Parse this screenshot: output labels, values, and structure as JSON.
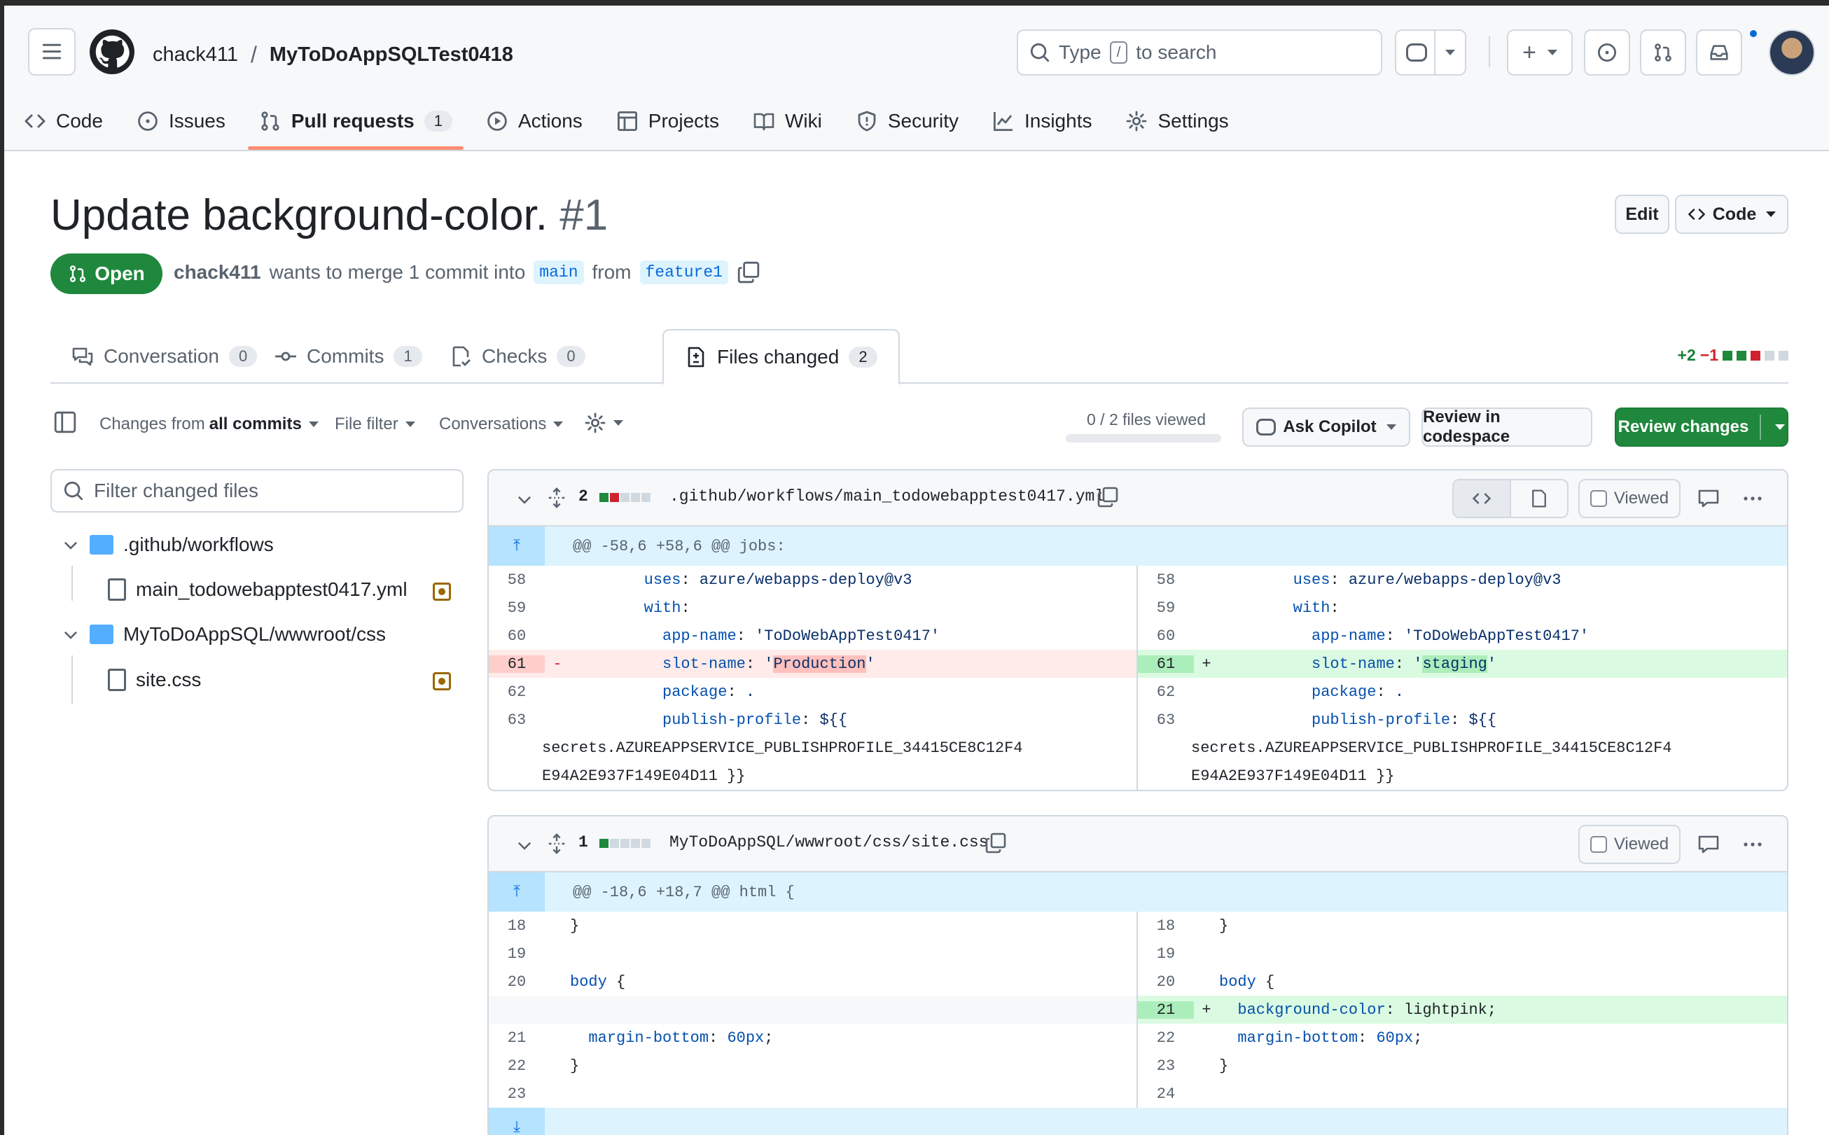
{
  "header": {
    "owner": "chack411",
    "separator": "/",
    "repo": "MyToDoAppSQLTest0418",
    "search": {
      "prefix": "Type",
      "key": "/",
      "suffix": "to search"
    }
  },
  "repo_tabs": [
    {
      "label": "Code",
      "icon": "code-icon"
    },
    {
      "label": "Issues",
      "icon": "issue-icon"
    },
    {
      "label": "Pull requests",
      "icon": "pull-request-icon",
      "count": "1",
      "active": true
    },
    {
      "label": "Actions",
      "icon": "play-icon"
    },
    {
      "label": "Projects",
      "icon": "table-icon"
    },
    {
      "label": "Wiki",
      "icon": "book-icon"
    },
    {
      "label": "Security",
      "icon": "shield-icon"
    },
    {
      "label": "Insights",
      "icon": "graph-icon"
    },
    {
      "label": "Settings",
      "icon": "gear-icon"
    }
  ],
  "pr": {
    "title": "Update background-color.",
    "number": "#1",
    "edit_label": "Edit",
    "code_label": "Code",
    "state": "Open",
    "author": "chack411",
    "merge_text": "wants to merge 1 commit into",
    "base": "main",
    "from_text": "from",
    "head": "feature1"
  },
  "pr_tabs": [
    {
      "label": "Conversation",
      "count": "0"
    },
    {
      "label": "Commits",
      "count": "1"
    },
    {
      "label": "Checks",
      "count": "0"
    },
    {
      "label": "Files changed",
      "count": "2",
      "active": true
    }
  ],
  "diffstat": {
    "additions": "+2",
    "deletions": "−1"
  },
  "toolbar": {
    "changes_prefix": "Changes from",
    "changes_value": "all commits",
    "file_filter": "File filter",
    "conversations": "Conversations",
    "files_viewed": "0 / 2 files viewed",
    "ask_copilot": "Ask Copilot",
    "review_codespace": "Review in codespace",
    "review_changes": "Review changes"
  },
  "file_tree": {
    "filter_placeholder": "Filter changed files",
    "items": [
      {
        "label": ".github/workflows",
        "type": "folder"
      },
      {
        "label": "main_todowebapptest0417.yml",
        "type": "file"
      },
      {
        "label": "MyToDoAppSQL/wwwroot/css",
        "type": "folder"
      },
      {
        "label": "site.css",
        "type": "file"
      }
    ]
  },
  "files": [
    {
      "path": ".github/workflows/main_todowebapptest0417.yml",
      "changes": "2",
      "viewed_label": "Viewed",
      "hunk": "@@ -58,6 +58,6 @@ jobs:"
    },
    {
      "path": "MyToDoAppSQL/wwwroot/css/site.css",
      "changes": "1",
      "viewed_label": "Viewed",
      "hunk": "@@ -18,6 +18,7 @@ html {"
    }
  ],
  "colors": {
    "accent": "#1f883d",
    "link": "#0969da",
    "tab_underline": "#fd8c73"
  }
}
